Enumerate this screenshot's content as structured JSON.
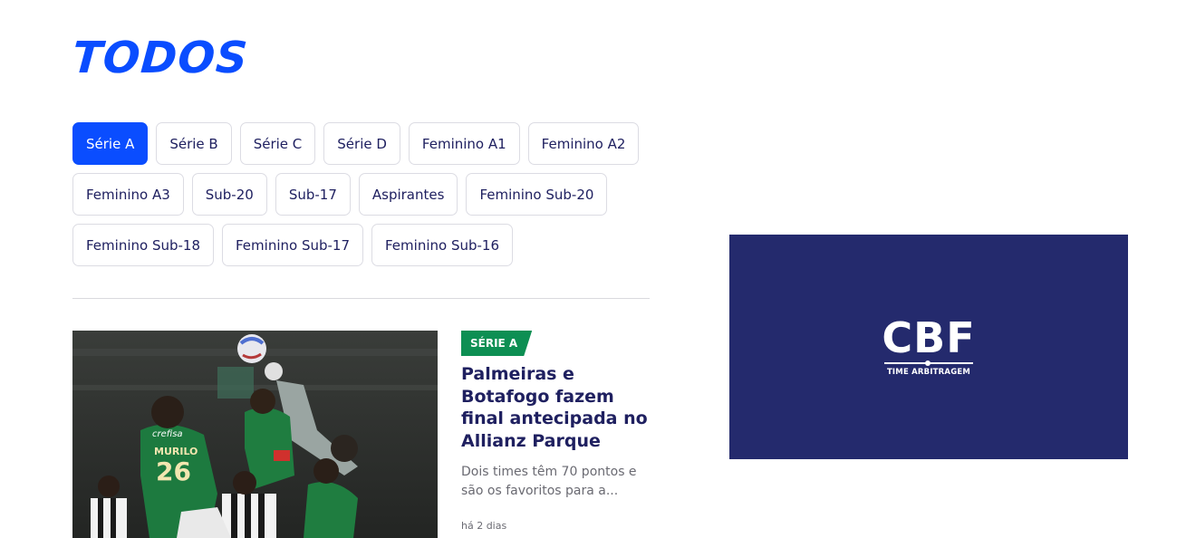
{
  "page": {
    "title": "TODOS"
  },
  "filters": {
    "rows": [
      [
        "Série A",
        "Série B",
        "Série C",
        "Série D",
        "Feminino A1",
        "Feminino A2"
      ],
      [
        "Feminino A3",
        "Sub-20",
        "Sub-17",
        "Aspirantes",
        "Feminino Sub-20"
      ],
      [
        "Feminino Sub-18",
        "Feminino Sub-17",
        "Feminino Sub-16"
      ]
    ],
    "active": "Série A"
  },
  "news": {
    "category": "SÉRIE A",
    "title": "Palmeiras e Botafogo fazem final antecipada no Allianz Parque",
    "excerpt": "Dois times têm 70 pontos e são os favoritos para a...",
    "time": "há 2 dias",
    "image_text": {
      "shirt_name": "MURILO",
      "shirt_number": "26",
      "sponsor": "crefisa"
    }
  },
  "ad": {
    "logo_text": "CBF",
    "logo_subtitle": "TIME ARBITRAGEM"
  },
  "colors": {
    "accent": "#0a4dff",
    "navy": "#1f2060",
    "badge_green": "#0d8f53",
    "ad_background": "#242a6d"
  }
}
